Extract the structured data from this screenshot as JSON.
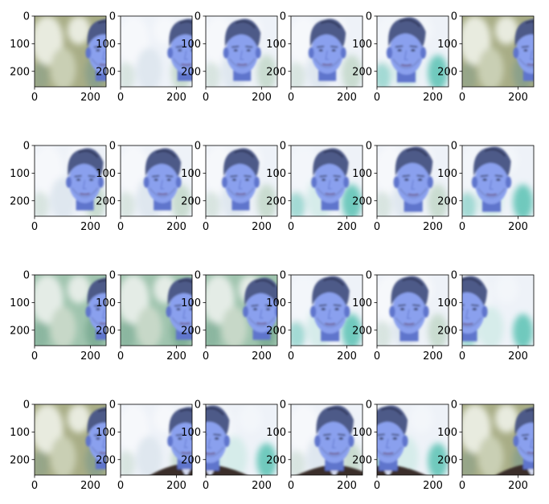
{
  "chart_data": {
    "type": "image_grid",
    "rows": 4,
    "cols": 6,
    "panel_image": "portrait of a man with swept-back hair, blue-tinted, blurred light background",
    "x_ticks": [
      0,
      200
    ],
    "y_ticks": [
      0,
      100,
      200
    ],
    "xlim": [
      0,
      256
    ],
    "ylim": [
      256,
      0
    ],
    "colors": {
      "skin": "#8aa0ee",
      "skin_shadow": "#5e74cc",
      "hair": "#4d5a88",
      "hair_dark": "#2f3658",
      "bg_light": "#eef2f8",
      "bg_green": "#9fc4ae",
      "bg_olive": "#a8ad86",
      "bg_teal": "#6fc9bd",
      "suit": "#3a2e2a"
    },
    "panels": [
      {
        "face_x": 250,
        "scale": 1.0,
        "bg": "olive",
        "suit": false
      },
      {
        "face_x": 235,
        "scale": 1.0,
        "bg": "light",
        "suit": false
      },
      {
        "face_x": 130,
        "scale": 1.0,
        "bg": "light",
        "suit": false
      },
      {
        "face_x": 130,
        "scale": 1.0,
        "bg": "light",
        "suit": false
      },
      {
        "face_x": 105,
        "scale": 1.05,
        "bg": "teal",
        "suit": false
      },
      {
        "face_x": 250,
        "scale": 1.0,
        "bg": "olive",
        "suit": false
      },
      {
        "face_x": 180,
        "scale": 1.0,
        "bg": "light",
        "suit": false
      },
      {
        "face_x": 150,
        "scale": 1.0,
        "bg": "light",
        "suit": false
      },
      {
        "face_x": 125,
        "scale": 1.0,
        "bg": "light",
        "suit": false
      },
      {
        "face_x": 140,
        "scale": 1.0,
        "bg": "teal",
        "suit": false
      },
      {
        "face_x": 130,
        "scale": 1.05,
        "bg": "light",
        "suit": false
      },
      {
        "face_x": 105,
        "scale": 1.05,
        "bg": "teal",
        "suit": false
      },
      {
        "face_x": 250,
        "scale": 1.0,
        "bg": "green",
        "suit": false
      },
      {
        "face_x": 230,
        "scale": 1.0,
        "bg": "green",
        "suit": false
      },
      {
        "face_x": 200,
        "scale": 1.0,
        "bg": "green",
        "suit": false
      },
      {
        "face_x": 140,
        "scale": 1.05,
        "bg": "teal",
        "suit": false
      },
      {
        "face_x": 115,
        "scale": 1.05,
        "bg": "light",
        "suit": false
      },
      {
        "face_x": 20,
        "scale": 1.05,
        "bg": "teal",
        "suit": false
      },
      {
        "face_x": 250,
        "scale": 1.0,
        "bg": "olive",
        "suit": false
      },
      {
        "face_x": 235,
        "scale": 1.0,
        "bg": "light",
        "suit": true
      },
      {
        "face_x": 15,
        "scale": 1.05,
        "bg": "teal",
        "suit": true
      },
      {
        "face_x": 155,
        "scale": 1.05,
        "bg": "light",
        "suit": true
      },
      {
        "face_x": 40,
        "scale": 1.05,
        "bg": "teal",
        "suit": true
      },
      {
        "face_x": 250,
        "scale": 1.0,
        "bg": "olive",
        "suit": true
      }
    ]
  }
}
